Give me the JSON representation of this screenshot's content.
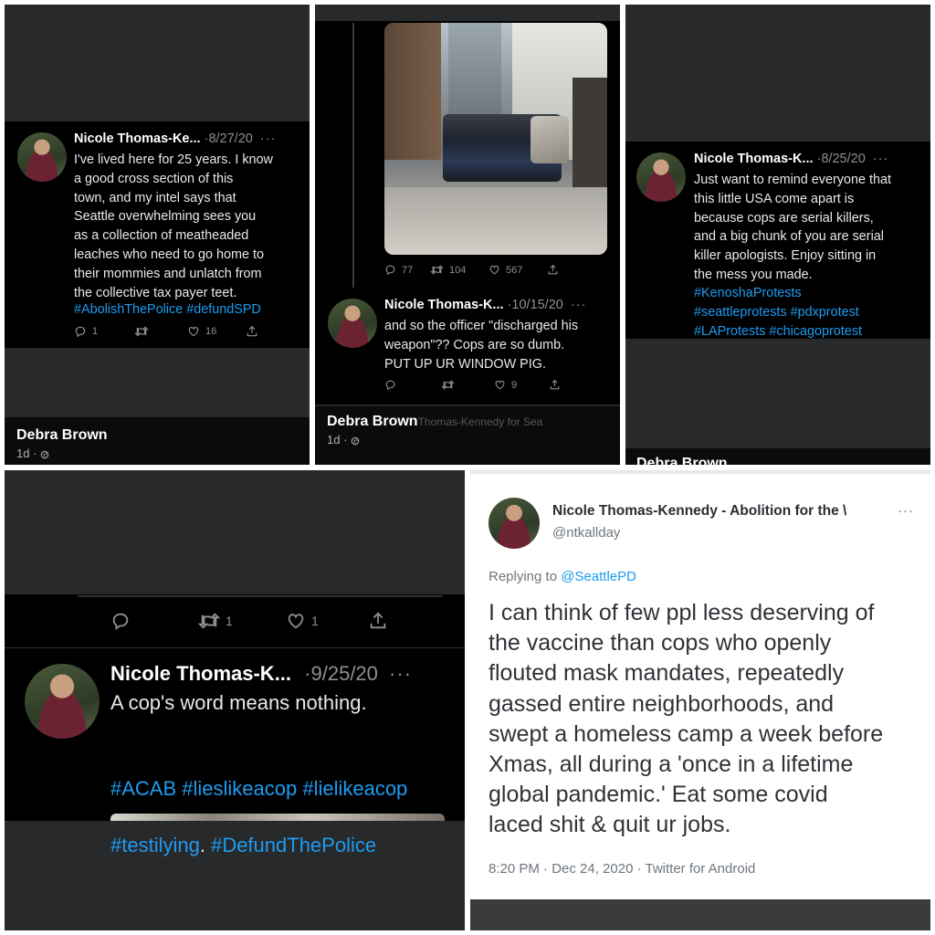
{
  "panel1": {
    "author": "Nicole Thomas-Ke...",
    "date": "·8/27/20",
    "more": "···",
    "text": "I've lived here for 25 years. I know\n a good cross section of this\ntown, and my intel says that\nSeattle overwhelming  sees you\nas a collection of meatheaded\nleaches who need to go home to\ntheir mommies and unlatch from\nthe collective tax payer teet.",
    "tags": "#AbolishThePolice #defundSPD",
    "reply_count": "1",
    "like_count": "16",
    "commenter": "Debra Brown",
    "commenter_time": "1d ·"
  },
  "panel2": {
    "top_reply": "77",
    "top_retweet": "104",
    "top_like": "567",
    "author": "Nicole Thomas-K...",
    "date": "·10/15/20",
    "more": "···",
    "text": "and so the officer \"discharged his\nweapon\"?? Cops are so dumb.\nPUT UP UR WINDOW PIG.",
    "like_count": "9",
    "commenter": "Debra Brown",
    "commenter_trail": "Thomas-Kennedy for Sea",
    "commenter_time": "1d ·"
  },
  "panel3": {
    "author": "Nicole Thomas-K...",
    "date": "·8/25/20",
    "more": "···",
    "text": "Just want to remind everyone that\nthis little USA come apart is\nbecause cops are serial killers,\nand a big chunk of you are serial\nkiller apologists. Enjoy sitting in\nthe mess you made.",
    "tags": "#KenoshaProtests\n#seattleprotests #pdxprotest\n#LAProtests #chicagoprotest",
    "commenter": "Debra Brown"
  },
  "panel4": {
    "retweet_count": "1",
    "like_count": "1",
    "author": "Nicole Thomas-K...",
    "date": "·9/25/20",
    "more": "···",
    "text": "A cop's word means nothing.",
    "tags_line1": "#ACAB #lieslikeacop #lielikeacop",
    "tags_line2_tag": "#testilying",
    "tags_line2_rest": ". ",
    "tags_line2_tag2": "#DefundThePolice"
  },
  "panel5": {
    "author": "Nicole Thomas-Kennedy - Abolition for the \\",
    "more": "···",
    "handle": "@ntkallday",
    "replying_prefix": "Replying to ",
    "replying_handle": "@SeattlePD",
    "text": "I can think of few ppl less deserving of\nthe vaccine than cops who openly\nflouted mask mandates, repeatedly\ngassed entire neighborhoods, and\nswept a homeless camp a week before\nXmas, all during a 'once in a lifetime\nglobal pandemic.' Eat some covid\nlaced shit & quit ur jobs.",
    "footer": "8:20 PM · Dec 24, 2020 · Twitter for Android"
  },
  "colors": {
    "accent": "#1d9bf0",
    "muted": "#8b9096",
    "panel_bg": "#28292b",
    "tweet_bg": "#000000"
  },
  "icons": [
    "reply-icon",
    "retweet-icon",
    "like-icon",
    "share-icon",
    "globe-icon"
  ]
}
